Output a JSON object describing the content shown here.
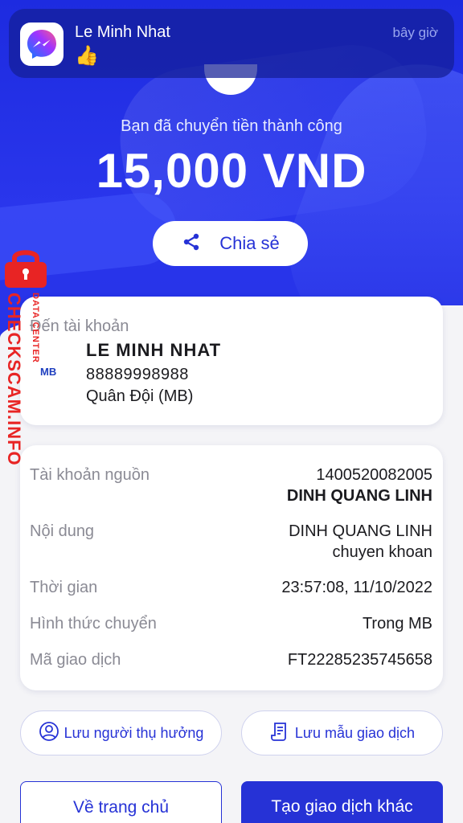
{
  "notification": {
    "app_icon": "messenger-icon",
    "sender": "Le Minh Nhat",
    "message": "👍",
    "time": "bây giờ"
  },
  "header": {
    "success_text": "Bạn đã chuyển tiền thành công",
    "amount": "15,000 VND",
    "share_label": "Chia sẻ",
    "share_icon": "share-icon"
  },
  "recipient": {
    "label": "Đến tài khoản",
    "name": "LE MINH NHAT",
    "account_number": "88889998988",
    "bank": "Quân Đội (MB)",
    "bank_logo_text": "MB"
  },
  "details": [
    {
      "label": "Tài khoản nguồn",
      "value": "1400520082005",
      "value2": "DINH QUANG LINH"
    },
    {
      "label": "Nội dung",
      "value": "DINH QUANG LINH",
      "value2": "chuyen khoan"
    },
    {
      "label": "Thời gian",
      "value": "23:57:08, 11/10/2022"
    },
    {
      "label": "Hình thức chuyển",
      "value": "Trong MB"
    },
    {
      "label": "Mã giao dịch",
      "value": "FT22285235745658"
    }
  ],
  "actions": {
    "save_beneficiary": "Lưu người thụ hưởng",
    "save_template": "Lưu mẫu giao dịch",
    "home": "Về trang chủ",
    "new_transaction": "Tạo giao dịch khác"
  },
  "watermark": {
    "brand": "CHECKSCAM.INFO",
    "sub": "DATA CENTER"
  },
  "colors": {
    "primary": "#2632d6",
    "hero": "#1d2be0",
    "watermark": "#e82424"
  }
}
